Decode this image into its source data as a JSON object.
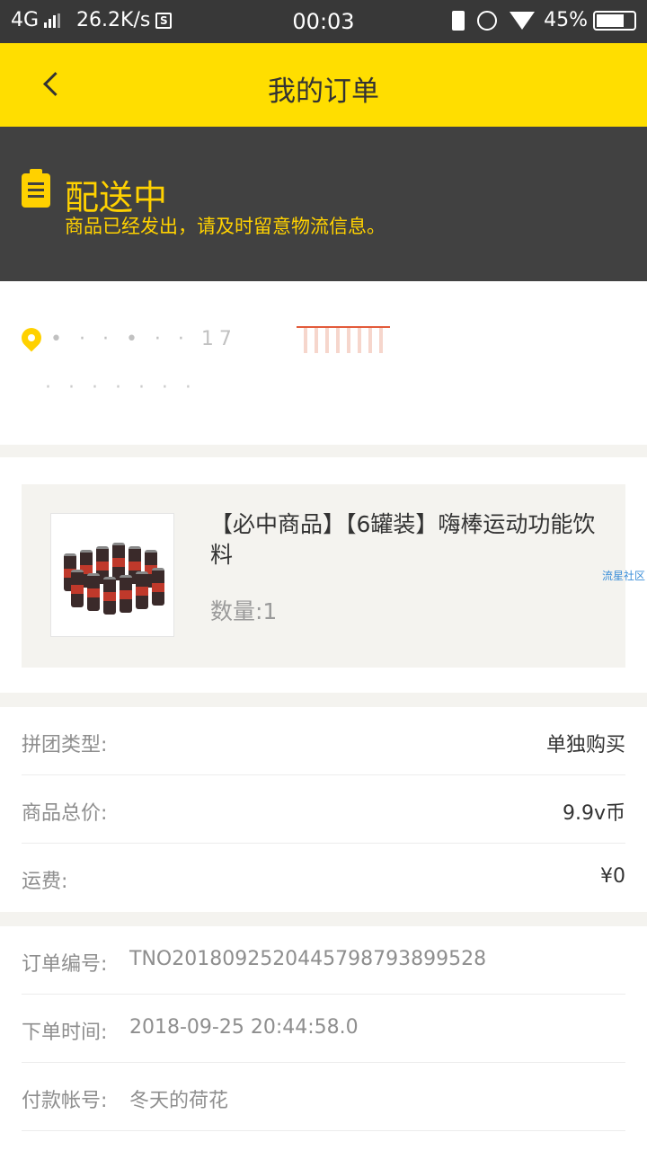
{
  "status_bar": {
    "network": "4G",
    "speed": "26.2K/s",
    "sync_badge": "S",
    "time": "00:03",
    "battery": "45%"
  },
  "header": {
    "title": "我的订单",
    "back_icon": "chevron-left-icon",
    "color": "#ffde00"
  },
  "order_status": {
    "title": "配送中",
    "description": "商品已经发出，请及时留意物流信息。",
    "icon": "clipboard-icon",
    "accent_color": "#ffd100"
  },
  "address": {
    "icon": "location-pin-icon",
    "line1": "•  ·  ·   •   ·   ·  17",
    "line2": "·   ·   ·   ·        ·  ·  ·"
  },
  "product": {
    "name": "【必中商品】【6罐装】嗨棒运动功能饮料",
    "quantity": "数量:1",
    "image_alt": "drink-cans-image"
  },
  "watermark": "流星社区",
  "price_info": [
    {
      "label": "拼团类型:",
      "value": "单独购买"
    },
    {
      "label": "商品总价:",
      "value": "9.9v币"
    },
    {
      "label": "运费:",
      "value": "¥0"
    }
  ],
  "order_info": [
    {
      "label": "订单编号:",
      "value": "TNO20180925204457987938995​28"
    },
    {
      "label": "下单时间:",
      "value": "2018-09-25 20:44:58.0"
    },
    {
      "label": "付款帐号:",
      "value": "冬天的荷花"
    }
  ]
}
